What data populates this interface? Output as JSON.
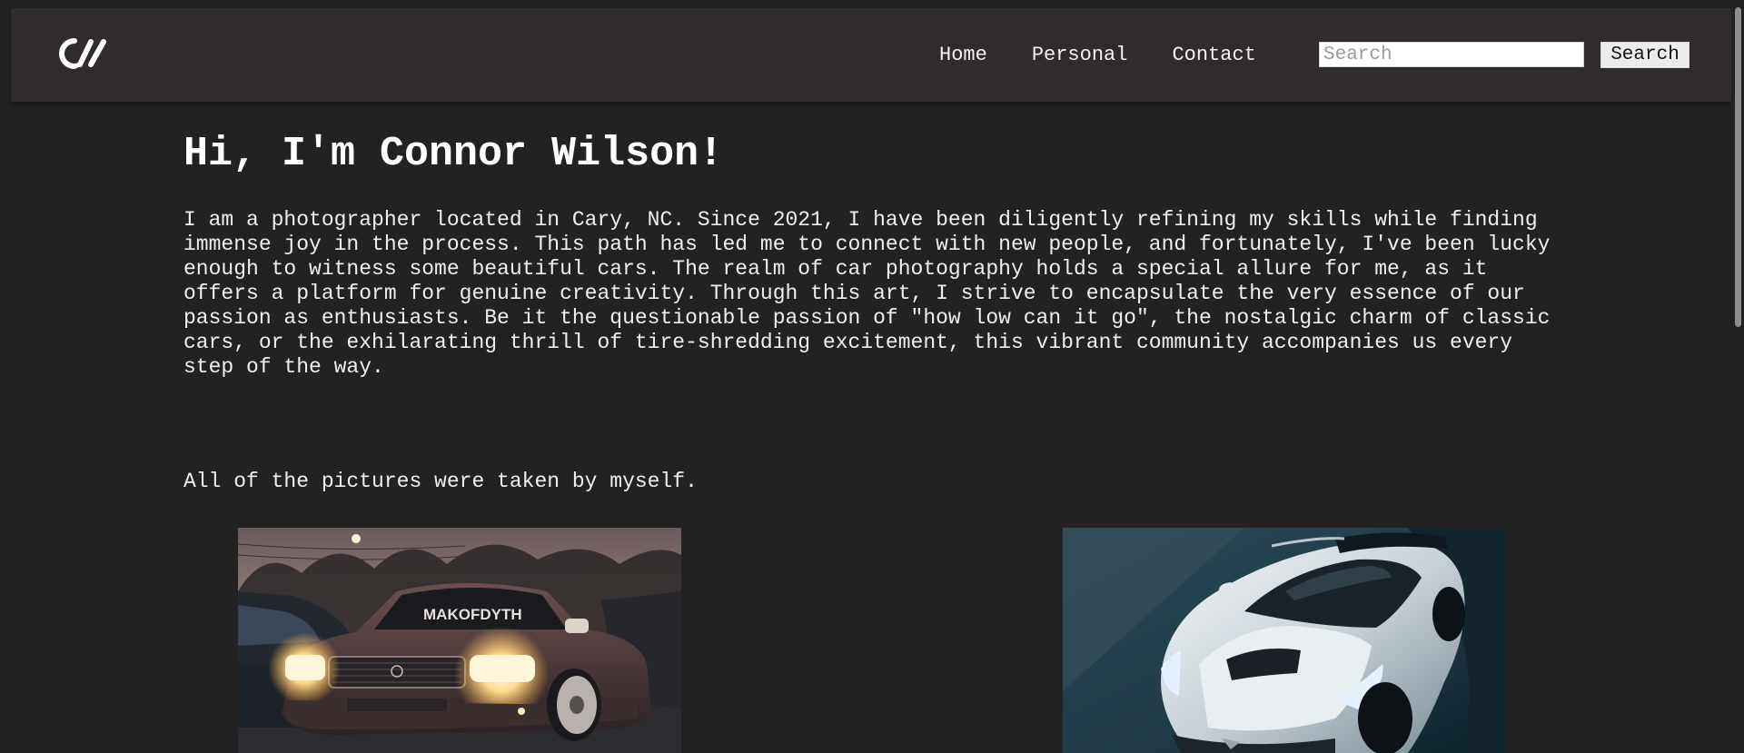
{
  "header": {
    "logo_text": "CW",
    "nav": [
      {
        "label": "Home"
      },
      {
        "label": "Personal"
      },
      {
        "label": "Contact"
      }
    ],
    "search": {
      "placeholder": "Search",
      "value": "",
      "button_label": "Search"
    }
  },
  "main": {
    "title": "Hi, I'm Connor Wilson!",
    "intro": "I am a photographer located in Cary, NC. Since 2021, I have been diligently refining my skills while finding immense joy in the process. This path has led me to connect with new people, and fortunately, I've been lucky enough to witness some beautiful cars. The realm of car photography holds a special allure for me, as it offers a platform for genuine creativity. Through this art, I strive to encapsulate the very essence of our passion as enthusiasts. Be it the questionable passion of \"how low can it go\", the nostalgic charm of classic cars, or the exhilarating thrill of tire-shredding excitement, this vibrant community accompanies us every step of the way.",
    "note": "All of the pictures were taken by myself.",
    "photos": [
      {
        "subject": "lowered-bronze-sedan-photo",
        "windshield_banner": "MAKOFDYTH"
      },
      {
        "subject": "white-sports-car-photo"
      }
    ]
  },
  "colors": {
    "background": "#222222",
    "navbar": "#302c2c",
    "text": "#f0f0f0"
  }
}
